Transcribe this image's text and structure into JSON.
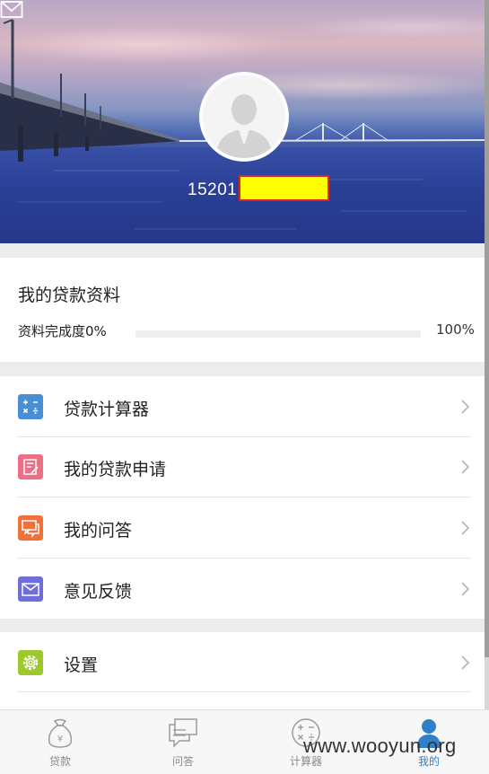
{
  "header": {
    "phone_prefix": "15201",
    "avatar_icon": "user-silhouette-icon",
    "message_icon": "mail-icon"
  },
  "loan_profile": {
    "title": "我的贷款资料",
    "progress_label": "资料完成度0%",
    "progress_value": 0,
    "progress_max_label": "100%"
  },
  "menu": {
    "items": [
      {
        "label": "贷款计算器",
        "icon": "calculator-icon",
        "color": "#4a8fd6"
      },
      {
        "label": "我的贷款申请",
        "icon": "application-form-icon",
        "color": "#ec6f86"
      },
      {
        "label": "我的问答",
        "icon": "chat-bubbles-icon",
        "color": "#f4703a"
      },
      {
        "label": "意见反馈",
        "icon": "feedback-envelope-icon",
        "color": "#6d6ed8"
      },
      {
        "label": "设置",
        "icon": "gear-icon",
        "color": "#9dc82b"
      }
    ]
  },
  "tabbar": {
    "tabs": [
      {
        "label": "贷款",
        "icon": "money-bag-icon"
      },
      {
        "label": "问答",
        "icon": "chat-icon"
      },
      {
        "label": "计算器",
        "icon": "calculator-icon"
      },
      {
        "label": "我的",
        "icon": "person-icon",
        "active": true
      }
    ]
  },
  "watermark": "www.wooyun.org"
}
